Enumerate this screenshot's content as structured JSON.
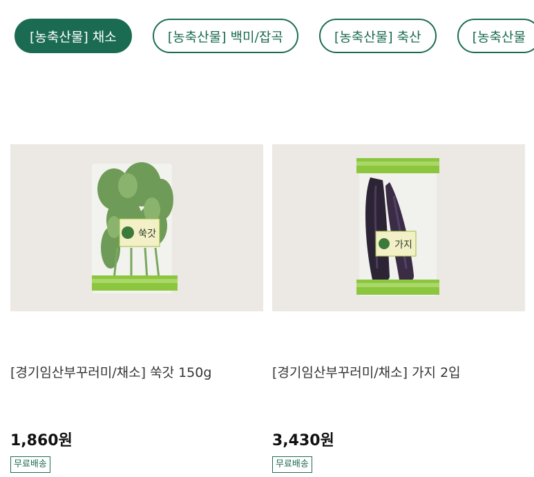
{
  "category_tabs": [
    {
      "label": "[농축산물] 채소",
      "active": true
    },
    {
      "label": "[농축산물] 백미/잡곡",
      "active": false
    },
    {
      "label": "[농축산물] 축산",
      "active": false
    },
    {
      "label": "[농축산물",
      "active": false
    }
  ],
  "products": [
    {
      "title": "[경기임산부꾸러미/채소] 쑥갓 150g",
      "price": "1,860원",
      "badge": "무료배송",
      "package_label": "쑥갓"
    },
    {
      "title": "[경기임산부꾸러미/채소] 가지 2입",
      "price": "3,430원",
      "badge": "무료배송",
      "package_label": "가지"
    }
  ],
  "colors": {
    "accent": "#1b6b52",
    "thumb_background": "#ece9e4"
  }
}
